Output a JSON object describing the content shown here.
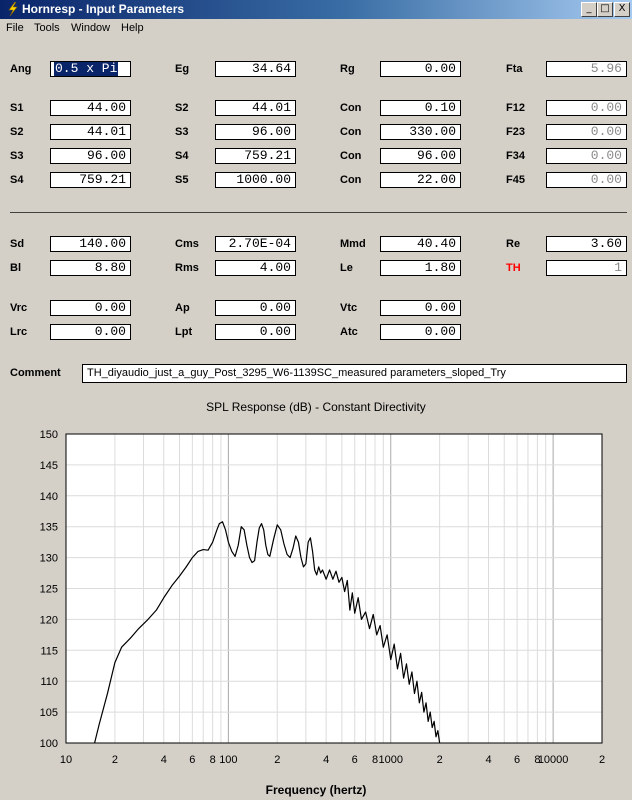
{
  "window": {
    "title": "Hornresp - Input Parameters",
    "buttons": [
      "_",
      "□",
      "X"
    ]
  },
  "menu": [
    "File",
    "Tools",
    "Window",
    "Help"
  ],
  "params": {
    "Ang": "0.5 x Pi",
    "Eg": "34.64",
    "Rg": "0.00",
    "Fta": "5.96",
    "S1": "44.00",
    "S2_mid": "44.01",
    "Con1": "0.10",
    "F12": "0.00",
    "S2": "44.01",
    "S3_mid": "96.00",
    "Con2": "330.00",
    "F23": "0.00",
    "S3": "96.00",
    "S4_mid": "759.21",
    "Con3": "96.00",
    "F34": "0.00",
    "S4": "759.21",
    "S5": "1000.00",
    "Con4": "22.00",
    "F45": "0.00",
    "Sd": "140.00",
    "Cms": "2.70E-04",
    "Mmd": "40.40",
    "Re": "3.60",
    "Bl": "8.80",
    "Rms": "4.00",
    "Le": "1.80",
    "TH": "1",
    "Vrc": "0.00",
    "Ap": "0.00",
    "Vtc": "0.00",
    "Lrc": "0.00",
    "Lpt": "0.00",
    "Atc": "0.00"
  },
  "labels": {
    "Ang": "Ang",
    "Eg": "Eg",
    "Rg": "Rg",
    "Fta": "Fta",
    "S1": "S1",
    "S2": "S2",
    "Con": "Con",
    "F12": "F12",
    "S3": "S3",
    "F23": "F23",
    "S4": "S4",
    "F34": "F34",
    "S5": "S5",
    "F45": "F45",
    "Sd": "Sd",
    "Cms": "Cms",
    "Mmd": "Mmd",
    "Re": "Re",
    "Bl": "Bl",
    "Rms": "Rms",
    "Le": "Le",
    "TH": "TH",
    "Vrc": "Vrc",
    "Ap": "Ap",
    "Vtc": "Vtc",
    "Lrc": "Lrc",
    "Lpt": "Lpt",
    "Atc": "Atc",
    "Comment": "Comment"
  },
  "comment": "TH_diyaudio_just_a_guy_Post_3295_W6-1139SC_measured parameters_sloped_Try",
  "colors": {
    "title_bar": "#0a246a",
    "th_label": "#ff0000",
    "window_bg": "#d4d0c8"
  },
  "chart_data": {
    "type": "line",
    "title": "SPL Response (dB) - Constant Directivity",
    "xlabel": "Frequency (hertz)",
    "ylabel": "",
    "xscale": "log",
    "xlim": [
      10,
      20000
    ],
    "ylim": [
      100,
      150
    ],
    "yticks": [
      100,
      105,
      110,
      115,
      120,
      125,
      130,
      135,
      140,
      145,
      150
    ],
    "xtick_labels": [
      "10",
      "2",
      "4",
      "6",
      "8",
      "100",
      "2",
      "4",
      "6",
      "8",
      "1000",
      "2",
      "4",
      "6",
      "8",
      "10000",
      "2"
    ],
    "xtick_values": [
      10,
      20,
      40,
      60,
      80,
      100,
      200,
      400,
      600,
      800,
      1000,
      2000,
      4000,
      6000,
      8000,
      10000,
      20000
    ],
    "grid": true,
    "series": [
      {
        "x": [
          15,
          16,
          18,
          20,
          22,
          25,
          28,
          32,
          36,
          40,
          45,
          50,
          55,
          60,
          65,
          70,
          75,
          80,
          85,
          88,
          92,
          96,
          100,
          105,
          110,
          115,
          120,
          125,
          130,
          135,
          140,
          145,
          150,
          155,
          160,
          165,
          170,
          175,
          180,
          190,
          200,
          210,
          220,
          230,
          240,
          250,
          260,
          270,
          280,
          290,
          300,
          310,
          320,
          330,
          340,
          350,
          360,
          370,
          380,
          400,
          420,
          440,
          460,
          480,
          500,
          520,
          540,
          560,
          580,
          600,
          630,
          660,
          700,
          740,
          780,
          820,
          860,
          900,
          950,
          1000,
          1050,
          1100,
          1150,
          1200,
          1250,
          1300,
          1350,
          1400,
          1450,
          1500,
          1550,
          1600,
          1650,
          1700,
          1750,
          1800,
          1850,
          1900,
          1950,
          2000
        ],
        "y": [
          100,
          103,
          108,
          113,
          115.5,
          117,
          118.5,
          120,
          121.5,
          123.5,
          125.5,
          127,
          128.5,
          130,
          131,
          131.3,
          131.2,
          132.5,
          134.5,
          135.5,
          135.8,
          134.5,
          132.5,
          131,
          130.2,
          132,
          135,
          134.5,
          132,
          130,
          129.2,
          129.5,
          132.5,
          134.8,
          135.5,
          134.5,
          132,
          130.5,
          130.2,
          133,
          135.3,
          134.5,
          132.2,
          130.5,
          130,
          131.5,
          133.5,
          132.5,
          130,
          128.5,
          129,
          132.5,
          133.2,
          131,
          128,
          127.2,
          128.5,
          127.5,
          128,
          126.5,
          128,
          126.5,
          127.8,
          126,
          126.8,
          124.5,
          126.3,
          121.5,
          124.3,
          121,
          123.5,
          120,
          121.2,
          118.5,
          120.8,
          117.5,
          119,
          115.5,
          117.5,
          113.5,
          116,
          112,
          114.5,
          110.5,
          112.8,
          109.5,
          111.5,
          108,
          110,
          106.5,
          108.2,
          105,
          106.5,
          103.5,
          105,
          102.5,
          103.5,
          101,
          102,
          100
        ]
      }
    ]
  }
}
